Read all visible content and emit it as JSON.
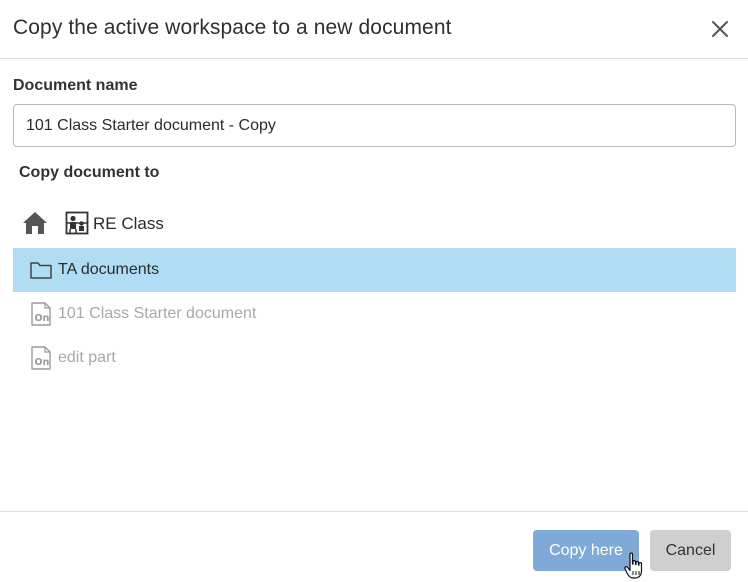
{
  "dialog": {
    "title": "Copy the active workspace to a new document",
    "close_icon": "close-icon"
  },
  "document_name": {
    "label": "Document name",
    "value": "101 Class Starter document - Copy"
  },
  "destination": {
    "label": "Copy document to",
    "breadcrumb": {
      "home_icon": "home-icon",
      "class_icon": "classroom-icon",
      "current": "RE Class"
    },
    "items": [
      {
        "label": "TA documents",
        "type": "folder",
        "icon": "folder-icon",
        "selected": true,
        "enabled": true
      },
      {
        "label": "101 Class Starter document",
        "type": "document",
        "icon": "onshape-document-icon",
        "selected": false,
        "enabled": false
      },
      {
        "label": "edit part",
        "type": "document",
        "icon": "onshape-document-icon",
        "selected": false,
        "enabled": false
      }
    ]
  },
  "footer": {
    "copy_label": "Copy here",
    "cancel_label": "Cancel"
  },
  "colors": {
    "selected_row": "#b0ddf4",
    "primary_button": "#7fa9d6",
    "secondary_button": "#cfcfcf",
    "disabled_text": "#a8a8a8"
  }
}
